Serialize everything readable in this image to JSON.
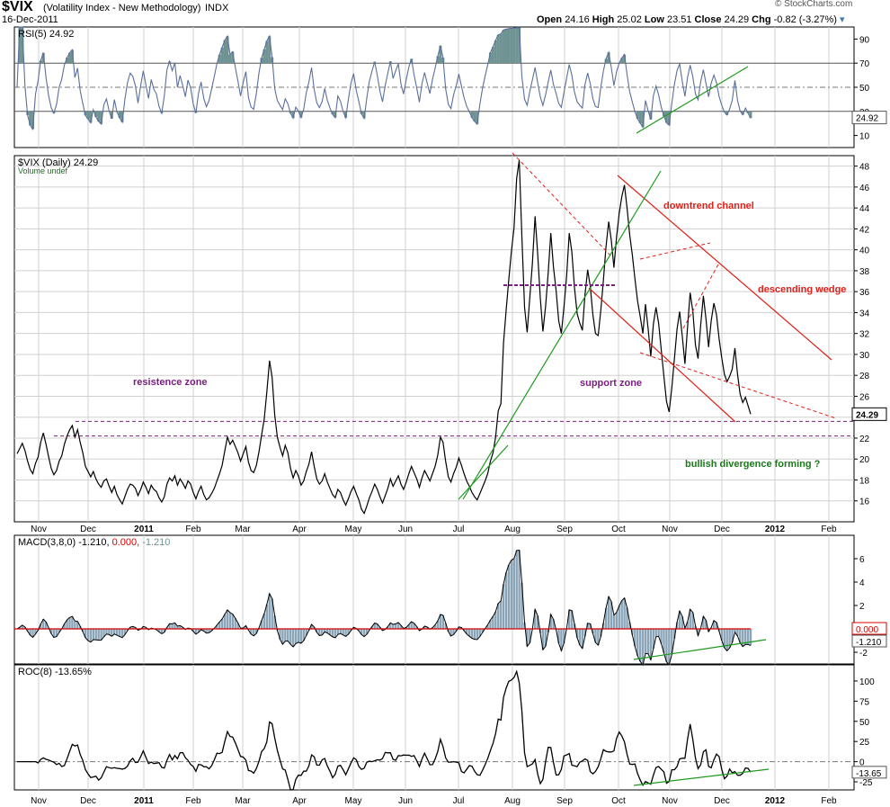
{
  "header": {
    "symbol": "$VIX",
    "name": "(Volatility Index - New Methodology)",
    "exchange": "INDX",
    "date": "16-Dec-2011",
    "watermark": "© StockCharts.com",
    "open_label": "Open",
    "open": "24.16",
    "high_label": "High",
    "high": "25.02",
    "low_label": "Low",
    "low": "23.51",
    "close_label": "Close",
    "close": "24.29",
    "chg_label": "Chg",
    "chg": "-0.82 (-3.27%)"
  },
  "time_axis": {
    "labels": [
      "Nov",
      "Dec",
      "2011",
      "Feb",
      "Mar",
      "Apr",
      "May",
      "Jun",
      "Jul",
      "Aug",
      "Sep",
      "Oct",
      "Nov",
      "Dec",
      "2012",
      "Feb"
    ],
    "bold": [
      "2011",
      "2012"
    ]
  },
  "colors": {
    "price": "#000000",
    "rsi": "#5b6f9a",
    "rsi_fill": "#6f9393",
    "macd_hist": "#8aa4b8",
    "signal": "#d40000",
    "trend_red": "#e0201a",
    "trend_green": "#1e9a1e",
    "zone_purple": "#7a1f80",
    "label_green": "#1a7a1a",
    "grid": "#d0d0d0"
  },
  "chart_data": [
    {
      "type": "line",
      "panel": "rsi",
      "title": "RSI(5) 24.92",
      "current_value": "24.92",
      "ylim": [
        0,
        100
      ],
      "yticks": [
        "10",
        "30",
        "50",
        "70",
        "90"
      ],
      "reference_lines": [
        30,
        50,
        70
      ]
    },
    {
      "type": "line",
      "panel": "price",
      "title": "$VIX (Daily) 24.29",
      "subtitle": "Volume undef",
      "current_value": "24.29",
      "ylim": [
        14,
        49
      ],
      "yticks": [
        "16",
        "18",
        "20",
        "22",
        "24",
        "26",
        "28",
        "30",
        "32",
        "34",
        "36",
        "38",
        "40",
        "42",
        "44",
        "46",
        "48"
      ],
      "series": [
        {
          "values": [
            20.5,
            21,
            21.5,
            20.8,
            19.8,
            19,
            18.6,
            19.6,
            20.2,
            21.6,
            22.5,
            21.4,
            20.2,
            19.1,
            18.5,
            18.9,
            19.8,
            20.3,
            21.4,
            22.2,
            22.8,
            23.2,
            22.1,
            22.8,
            21.6,
            20.6,
            19.3,
            18.8,
            18.3,
            18.8,
            18.1,
            17.6,
            17.3,
            17.9,
            18.1,
            17.4,
            16.8,
            17.4,
            16.6,
            16.1,
            15.7,
            16.4,
            17.1,
            17.6,
            17.5,
            17.2,
            16.5,
            17.1,
            17.8,
            17.3,
            16.7,
            17.5,
            17.1,
            16.9,
            16.3,
            15.9,
            16.4,
            17.6,
            18.2,
            17.9,
            18.4,
            17.5,
            18.1,
            17.7,
            17.2,
            17.9,
            17.6,
            16.8,
            16.2,
            16.9,
            17.4,
            16.6,
            16.1,
            16.3,
            16.7,
            17.2,
            17.9,
            18.6,
            19.4,
            20.8,
            22.1,
            21.4,
            21.8,
            21.2,
            20.6,
            19.8,
            20.5,
            21.2,
            19.7,
            18.9,
            18.7,
            19.4,
            20.7,
            22.3,
            23.8,
            26.4,
            29.4,
            27.8,
            24.2,
            22.1,
            21.1,
            20.3,
            21.3,
            20.6,
            19.1,
            18.2,
            18.9,
            18.4,
            17.5,
            17.9,
            18.8,
            19.5,
            20.7,
            19.3,
            18.1,
            17.6,
            17.9,
            18.6,
            17.8,
            17.2,
            16.6,
            16.3,
            17.1,
            16.8,
            16.1,
            15.6,
            16.2,
            16.9,
            17.4,
            16.7,
            16.1,
            15.2,
            14.8,
            15.5,
            16.3,
            16.9,
            17.6,
            17.1,
            16.4,
            15.8,
            16.5,
            17.2,
            18.1,
            17.4,
            17.9,
            18.4,
            17.6,
            17.1,
            17.8,
            18.6,
            19.3,
            18.7,
            18.1,
            17.3,
            18.2,
            18.9,
            18.4,
            17.9,
            18.6,
            19.3,
            20.4,
            22.1,
            21.6,
            19.8,
            18.3,
            17.8,
            18.6,
            19.2,
            20.1,
            19.4,
            18.6,
            17.9,
            17.4,
            16.8,
            16.4,
            16.1,
            16.7,
            17.3,
            17.9,
            18.6,
            19.8,
            20.6,
            22.1,
            24.6,
            25.3,
            31.1,
            34.2,
            37.1,
            39.8,
            42.1,
            46.8,
            48.6,
            41.3,
            34.5,
            32.1,
            35.4,
            38.7,
            43.2,
            39.6,
            35.4,
            32.2,
            34.6,
            37.8,
            41.6,
            38.4,
            36.1,
            33.2,
            32.0,
            34.5,
            37.5,
            41.6,
            39.8,
            36.4,
            33.9,
            33.0,
            32.3,
            35.7,
            38.1,
            36.5,
            33.8,
            32.0,
            31.8,
            34.2,
            37.1,
            40.3,
            42.7,
            40.9,
            38.3,
            41.2,
            43.5,
            45.1,
            46.2,
            44.0,
            41.4,
            39.5,
            37.2,
            35.1,
            33.6,
            32.0,
            34.8,
            32.5,
            29.8,
            32.9,
            34.5,
            33.0,
            30.4,
            27.9,
            25.5,
            24.5,
            26.8,
            29.6,
            32.4,
            34.1,
            31.7,
            29.1,
            32.6,
            35.9,
            34.1,
            30.9,
            29.6,
            32.8,
            35.6,
            33.4,
            30.7,
            33.2,
            34.9,
            33.8,
            31.5,
            29.7,
            28.1,
            27.4,
            27.9,
            28.6,
            30.6,
            28.1,
            26.2,
            25.4,
            25.9,
            25.1,
            24.29
          ]
        }
      ],
      "annotations": [
        "downtrend channel",
        "descending wedge",
        "resistence zone",
        "support zone",
        "bullish divergence forming ?"
      ],
      "zones": [
        23.6,
        22.2
      ]
    },
    {
      "type": "bar",
      "panel": "macd",
      "title": "MACD(3,8,0) -1.210, 0.000, -1.210",
      "title_parts": [
        "MACD(3,8,0)",
        "-1.210,",
        "0.000,",
        "-1.210"
      ],
      "ylim": [
        -3,
        8
      ],
      "yticks": [
        "-2",
        "0",
        "2",
        "4",
        "6"
      ],
      "labels": [
        "0.000",
        "-1.210"
      ]
    },
    {
      "type": "line",
      "panel": "roc",
      "title": "ROC(8) -13.65%",
      "current_value": "-13.65",
      "ylim": [
        -35,
        120
      ],
      "yticks": [
        "-25",
        "0",
        "25",
        "50",
        "75",
        "100"
      ]
    }
  ]
}
